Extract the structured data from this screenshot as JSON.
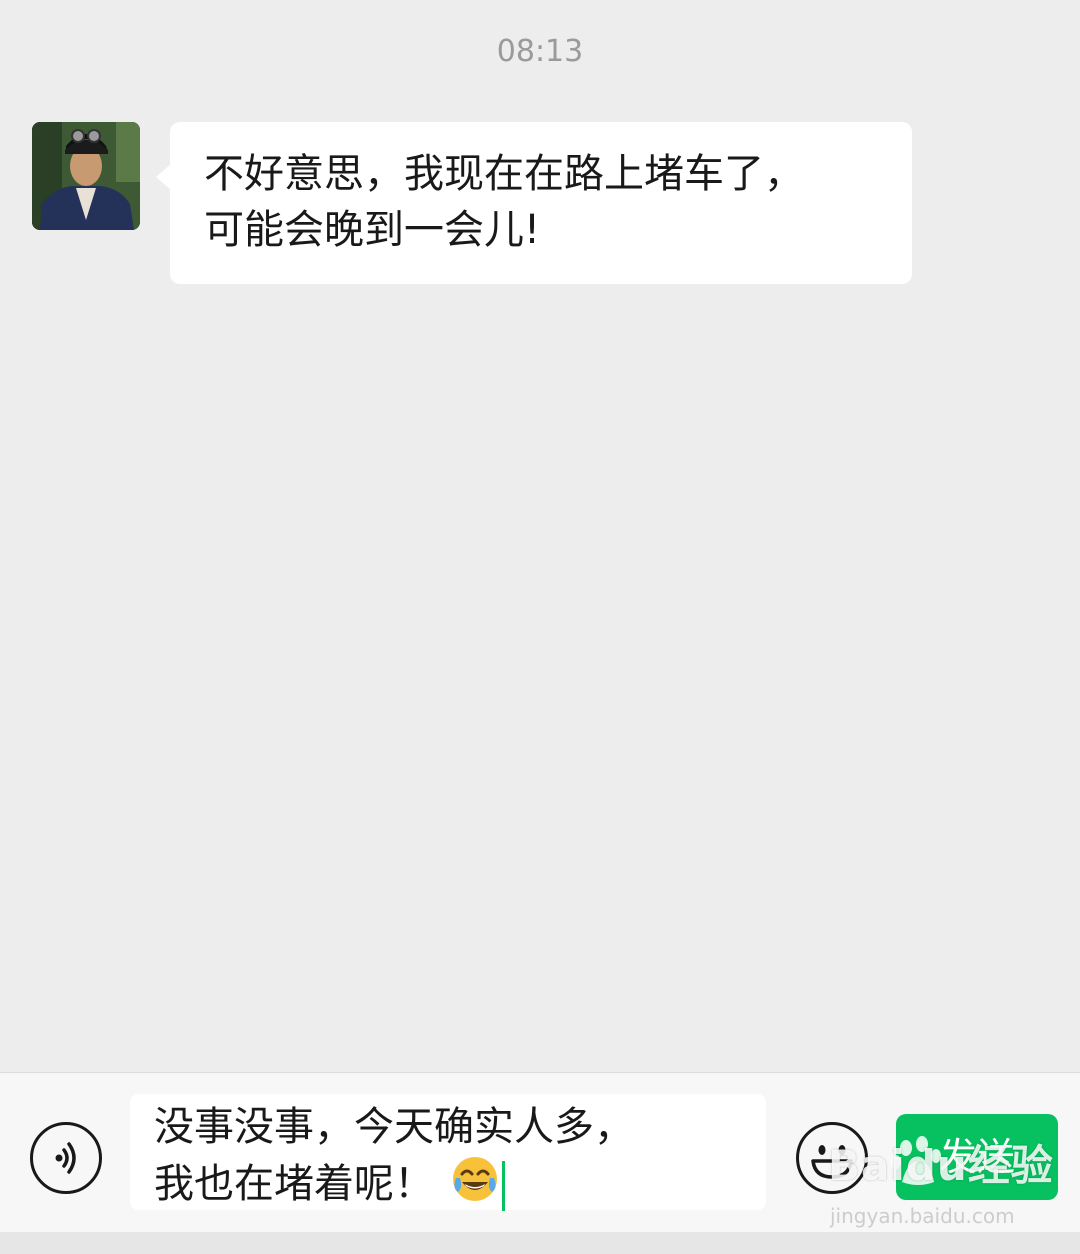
{
  "timestamp": "08:13",
  "conversation": {
    "incoming": {
      "avatar_icon": "user-avatar-photo",
      "lines": [
        "不好意思，我现在在路上堵车了，",
        "可能会晚到一会儿!"
      ]
    }
  },
  "input_bar": {
    "voice_icon": "voice-toggle-icon",
    "text_lines": [
      "没事没事，今天确实人多，",
      "我也在堵着呢！"
    ],
    "inline_emoji": "tears-of-joy-emoji",
    "emoji_icon": "smiley-face-icon",
    "send_label": "发送",
    "accent_color": "#07c160"
  },
  "watermark": {
    "brand": "Baidu经验",
    "url": "jingyan.baidu.com"
  }
}
